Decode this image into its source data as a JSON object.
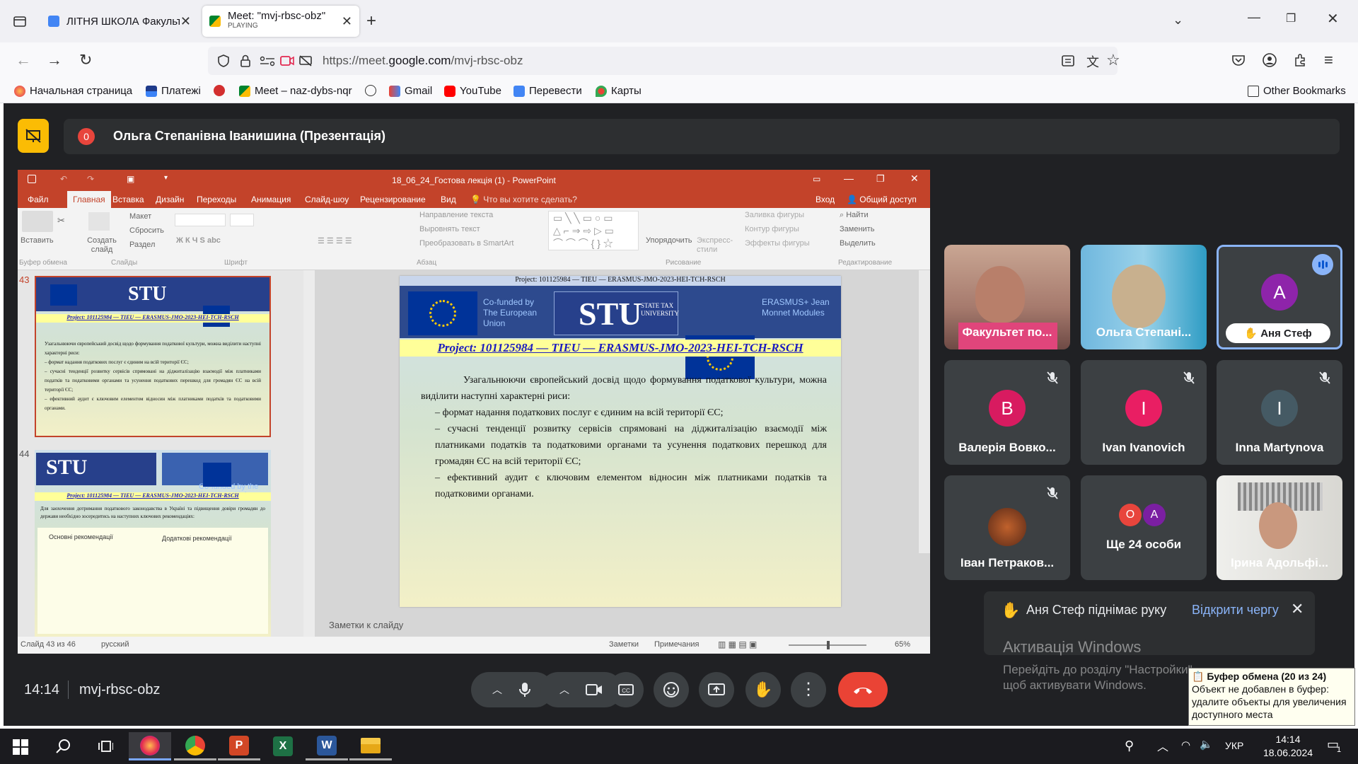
{
  "browser": {
    "tabs": [
      {
        "title": "ЛІТНЯ ШКОЛА Факультету под",
        "sub": ""
      },
      {
        "title": "Meet: \"mvj-rbsc-obz\"",
        "sub": "PLAYING"
      }
    ],
    "url_prefix": "https://meet.",
    "url_domain": "google.com",
    "url_path": "/mvj-rbsc-obz",
    "bookmarks": [
      "Начальная страница",
      "Платежі",
      "Meet – naz-dybs-nqr",
      "Gmail",
      "YouTube",
      "Перевести",
      "Карты"
    ],
    "other_bookmarks": "Other Bookmarks"
  },
  "meet": {
    "presenter_badge": "0",
    "presenter": "Ольга Степанівна Іванишина (Презентація)",
    "time": "14:14",
    "meeting_code": "mvj-rbsc-obz",
    "participants": [
      {
        "name": "Факультет по...",
        "initial": "",
        "color": ""
      },
      {
        "name": "Ольга Степані...",
        "initial": "",
        "color": ""
      },
      {
        "name": "Аня Стеф",
        "initial": "A",
        "color": "#8e24aa"
      },
      {
        "name": "Валерія Вовко...",
        "initial": "В",
        "color": "#d81b60"
      },
      {
        "name": "Ivan Ivanovich",
        "initial": "I",
        "color": "#e91e63"
      },
      {
        "name": "Inna Martynova",
        "initial": "I",
        "color": "#455a64"
      },
      {
        "name": "Іван Петраков...",
        "initial": "",
        "color": ""
      },
      {
        "name": "Ще 24 особи",
        "initial": "",
        "color": ""
      },
      {
        "name": "Ірина Адольфі...",
        "initial": "",
        "color": ""
      }
    ],
    "more_avatars": [
      "O",
      "A"
    ],
    "hand_notice": "Аня Стеф піднімає руку",
    "open_queue": "Відкрити чергу"
  },
  "ppt": {
    "title": "18_06_24_Гостова лекція (1) - PowerPoint",
    "menu": [
      "Файл",
      "Главная",
      "Вставка",
      "Дизайн",
      "Переходы",
      "Анимация",
      "Слайд-шоу",
      "Рецензирование",
      "Вид"
    ],
    "tell_me": "Что вы хотите сделать?",
    "login": "Вход",
    "share": "Общий доступ",
    "ribbon_groups": [
      "Буфер обмена",
      "Слайды",
      "Шрифт",
      "Абзац",
      "Рисование",
      "Редактирование"
    ],
    "ribbon_items": {
      "paste": "Вставить",
      "create": "Создать слайд",
      "layout": "Макет",
      "reset": "Сбросить",
      "section": "Раздел",
      "text_dir": "Направление текста",
      "align_text": "Выровнять текст",
      "smartart": "Преобразовать в SmartArt",
      "arrange": "Упорядочить",
      "quick_styles": "Экспресс-стили",
      "fill": "Заливка фигуры",
      "outline": "Контур фигуры",
      "effects": "Эффекты фигуры",
      "find": "Найти",
      "replace": "Заменить",
      "select": "Выделить"
    },
    "thumb_numbers": [
      "43",
      "44"
    ],
    "status_slide": "Слайд 43 из 46",
    "status_lang": "русский",
    "status_notes": "Заметки",
    "status_comments": "Примечания",
    "zoom": "65%",
    "notes_placeholder": "Заметки к слайду"
  },
  "slide": {
    "header_project": "Project: 101125984 — TIEU — ERASMUS-JMO-2023-HEI-TCH-RSCH",
    "cofunded": "Co-funded by The European Union",
    "stu": "STU",
    "stu_sub": "STATE TAX UNIVERSITY",
    "erasmus": "ERASMUS+ Jean Monnet Modules",
    "project_line": "Project: 101125984 — TIEU — ERASMUS-JMO-2023-HEI-TCH-RSCH",
    "p1": "Узагальнюючи європейський досвід щодо формування податкової культури, можна виділити наступні характерні риси:",
    "b1": "– формат надання податкових послуг є єдиним на всій території ЄС;",
    "b2": "– сучасні тенденції розвитку сервісів спрямовані на діджиталізацію взаємодії між платниками податків та податковими органами та усунення податкових перешкод для громадян ЄС на всій території ЄС;",
    "b3": "– ефективний аудит є ключовим елементом відносин між платниками податків та податковими органами."
  },
  "slide44": {
    "cofunded": "Co-funded by the European Union",
    "text": "Для заохочення дотримання податкового законодавства в Україні та підвищення довіри громадян до держави необхідно зосередитись на наступних ключових рекомендаціях:",
    "col1": "Основні рекомендації",
    "col2": "Додаткові рекомендації"
  },
  "windows_activation": {
    "title": "Активація Windows",
    "text": "Перейдіть до розділу \"Настройки\", щоб активувати Windows."
  },
  "clipboard": {
    "title": "Буфер обмена (20 из 24)",
    "text": "Объект не добавлен в буфер: удалите объекты для увеличения доступного места"
  },
  "taskbar": {
    "lang": "УКР",
    "time": "14:14",
    "date": "18.06.2024",
    "notif": "1"
  },
  "colors": {
    "accent": "#8ab4f8",
    "end_call": "#ea4335",
    "meet_bg": "#202124",
    "ppt_red": "#c3432a"
  }
}
